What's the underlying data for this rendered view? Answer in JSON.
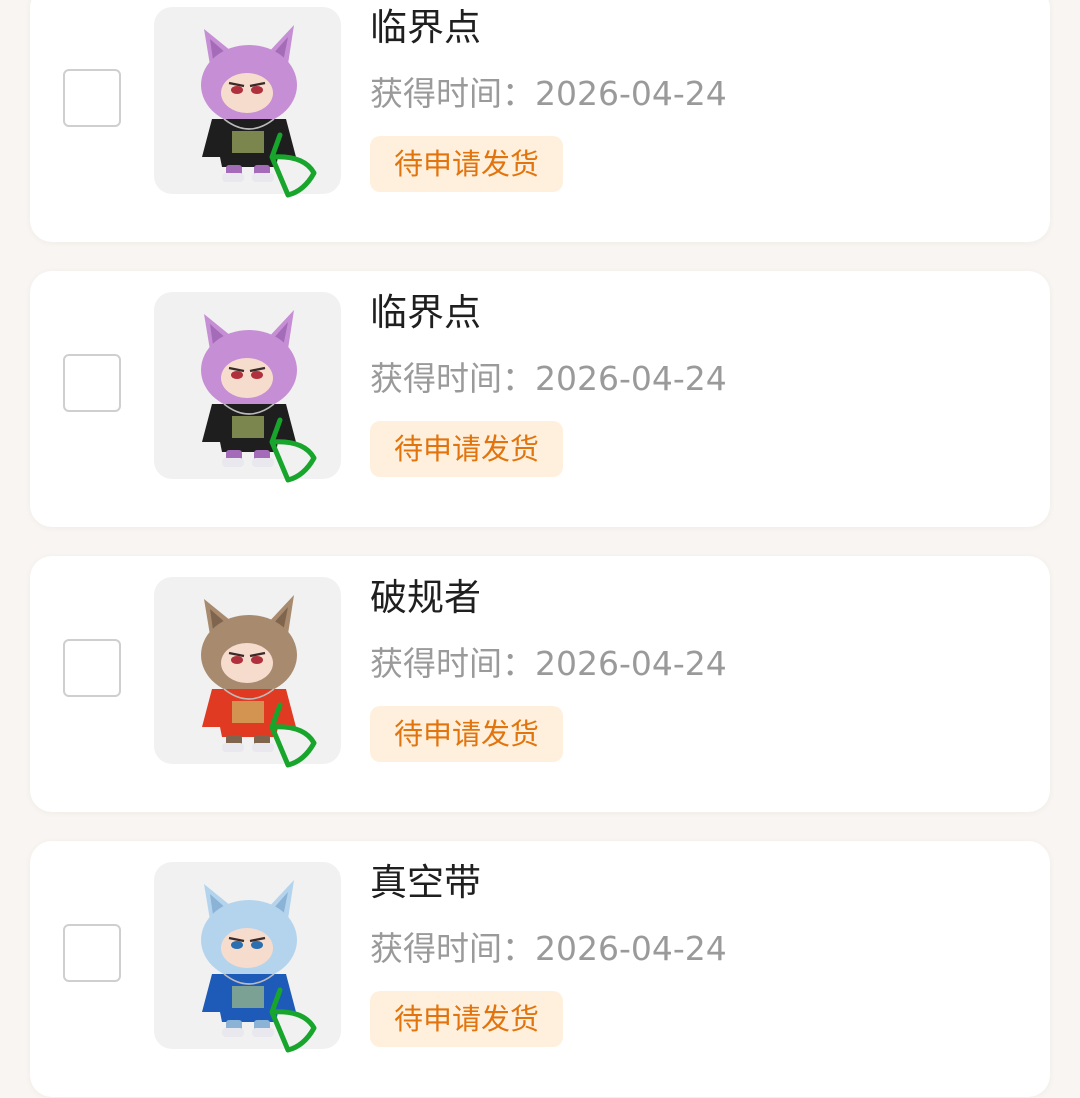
{
  "items": [
    {
      "title": "临界点",
      "time_label": "获得时间：",
      "time_value": "2026-04-24",
      "status": "待申请发货",
      "colors": {
        "fur": "#c68ed4",
        "fur_dark": "#a46bb8",
        "shirt": "#1e1e1e",
        "eyes": "#b0313d",
        "mark": "#17a52c"
      }
    },
    {
      "title": "临界点",
      "time_label": "获得时间：",
      "time_value": "2026-04-24",
      "status": "待申请发货",
      "colors": {
        "fur": "#c68ed4",
        "fur_dark": "#a46bb8",
        "shirt": "#1e1e1e",
        "eyes": "#b0313d",
        "mark": "#17a52c"
      }
    },
    {
      "title": "破规者",
      "time_label": "获得时间：",
      "time_value": "2026-04-24",
      "status": "待申请发货",
      "colors": {
        "fur": "#a88a6e",
        "fur_dark": "#7f654d",
        "shirt": "#e03a22",
        "eyes": "#b0313d",
        "mark": "#17a52c"
      }
    },
    {
      "title": "真空带",
      "time_label": "获得时间：",
      "time_value": "2026-04-24",
      "status": "待申请发货",
      "colors": {
        "fur": "#b4d4ee",
        "fur_dark": "#8bb3d6",
        "shirt": "#1e5ab8",
        "eyes": "#2b6fb0",
        "mark": "#17a52c"
      }
    }
  ]
}
